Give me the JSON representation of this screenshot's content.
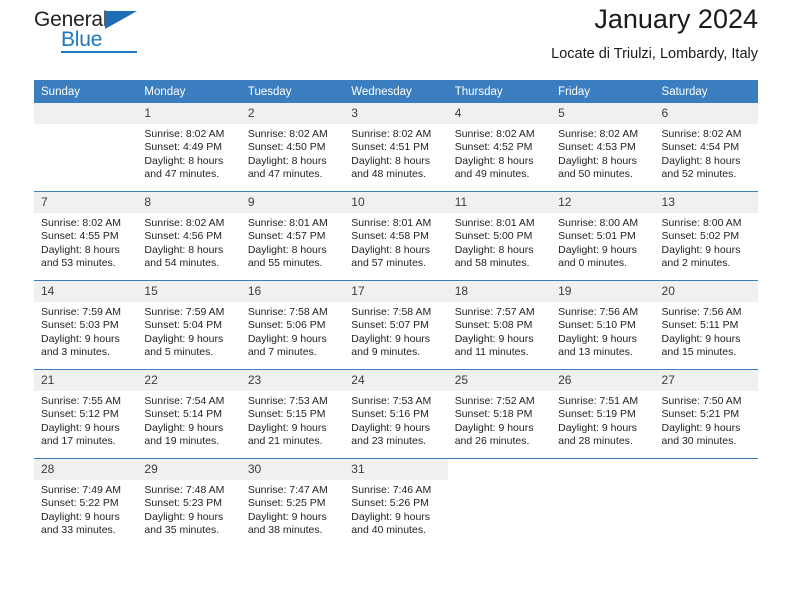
{
  "brand": {
    "name_part1": "General",
    "name_part2": "Blue",
    "logo_icon": "blue-triangle-icon"
  },
  "header": {
    "title": "January 2024",
    "subtitle": "Locate di Triulzi, Lombardy, Italy"
  },
  "colors": {
    "header_blue": "#3a7ebf",
    "brand_blue": "#1f78bf",
    "daynum_band": "#f0f0f0",
    "text": "#232323"
  },
  "weekdays": [
    "Sunday",
    "Monday",
    "Tuesday",
    "Wednesday",
    "Thursday",
    "Friday",
    "Saturday"
  ],
  "labels": {
    "sunrise_prefix": "Sunrise:",
    "sunset_prefix": "Sunset:",
    "daylight_prefix": "Daylight:"
  },
  "weeks": [
    [
      {
        "day": "",
        "empty": true
      },
      {
        "day": "1",
        "sunrise": "Sunrise: 8:02 AM",
        "sunset": "Sunset: 4:49 PM",
        "daylight_line1": "Daylight: 8 hours",
        "daylight_line2": "and 47 minutes."
      },
      {
        "day": "2",
        "sunrise": "Sunrise: 8:02 AM",
        "sunset": "Sunset: 4:50 PM",
        "daylight_line1": "Daylight: 8 hours",
        "daylight_line2": "and 47 minutes."
      },
      {
        "day": "3",
        "sunrise": "Sunrise: 8:02 AM",
        "sunset": "Sunset: 4:51 PM",
        "daylight_line1": "Daylight: 8 hours",
        "daylight_line2": "and 48 minutes."
      },
      {
        "day": "4",
        "sunrise": "Sunrise: 8:02 AM",
        "sunset": "Sunset: 4:52 PM",
        "daylight_line1": "Daylight: 8 hours",
        "daylight_line2": "and 49 minutes."
      },
      {
        "day": "5",
        "sunrise": "Sunrise: 8:02 AM",
        "sunset": "Sunset: 4:53 PM",
        "daylight_line1": "Daylight: 8 hours",
        "daylight_line2": "and 50 minutes."
      },
      {
        "day": "6",
        "sunrise": "Sunrise: 8:02 AM",
        "sunset": "Sunset: 4:54 PM",
        "daylight_line1": "Daylight: 8 hours",
        "daylight_line2": "and 52 minutes."
      }
    ],
    [
      {
        "day": "7",
        "sunrise": "Sunrise: 8:02 AM",
        "sunset": "Sunset: 4:55 PM",
        "daylight_line1": "Daylight: 8 hours",
        "daylight_line2": "and 53 minutes."
      },
      {
        "day": "8",
        "sunrise": "Sunrise: 8:02 AM",
        "sunset": "Sunset: 4:56 PM",
        "daylight_line1": "Daylight: 8 hours",
        "daylight_line2": "and 54 minutes."
      },
      {
        "day": "9",
        "sunrise": "Sunrise: 8:01 AM",
        "sunset": "Sunset: 4:57 PM",
        "daylight_line1": "Daylight: 8 hours",
        "daylight_line2": "and 55 minutes."
      },
      {
        "day": "10",
        "sunrise": "Sunrise: 8:01 AM",
        "sunset": "Sunset: 4:58 PM",
        "daylight_line1": "Daylight: 8 hours",
        "daylight_line2": "and 57 minutes."
      },
      {
        "day": "11",
        "sunrise": "Sunrise: 8:01 AM",
        "sunset": "Sunset: 5:00 PM",
        "daylight_line1": "Daylight: 8 hours",
        "daylight_line2": "and 58 minutes."
      },
      {
        "day": "12",
        "sunrise": "Sunrise: 8:00 AM",
        "sunset": "Sunset: 5:01 PM",
        "daylight_line1": "Daylight: 9 hours",
        "daylight_line2": "and 0 minutes."
      },
      {
        "day": "13",
        "sunrise": "Sunrise: 8:00 AM",
        "sunset": "Sunset: 5:02 PM",
        "daylight_line1": "Daylight: 9 hours",
        "daylight_line2": "and 2 minutes."
      }
    ],
    [
      {
        "day": "14",
        "sunrise": "Sunrise: 7:59 AM",
        "sunset": "Sunset: 5:03 PM",
        "daylight_line1": "Daylight: 9 hours",
        "daylight_line2": "and 3 minutes."
      },
      {
        "day": "15",
        "sunrise": "Sunrise: 7:59 AM",
        "sunset": "Sunset: 5:04 PM",
        "daylight_line1": "Daylight: 9 hours",
        "daylight_line2": "and 5 minutes."
      },
      {
        "day": "16",
        "sunrise": "Sunrise: 7:58 AM",
        "sunset": "Sunset: 5:06 PM",
        "daylight_line1": "Daylight: 9 hours",
        "daylight_line2": "and 7 minutes."
      },
      {
        "day": "17",
        "sunrise": "Sunrise: 7:58 AM",
        "sunset": "Sunset: 5:07 PM",
        "daylight_line1": "Daylight: 9 hours",
        "daylight_line2": "and 9 minutes."
      },
      {
        "day": "18",
        "sunrise": "Sunrise: 7:57 AM",
        "sunset": "Sunset: 5:08 PM",
        "daylight_line1": "Daylight: 9 hours",
        "daylight_line2": "and 11 minutes."
      },
      {
        "day": "19",
        "sunrise": "Sunrise: 7:56 AM",
        "sunset": "Sunset: 5:10 PM",
        "daylight_line1": "Daylight: 9 hours",
        "daylight_line2": "and 13 minutes."
      },
      {
        "day": "20",
        "sunrise": "Sunrise: 7:56 AM",
        "sunset": "Sunset: 5:11 PM",
        "daylight_line1": "Daylight: 9 hours",
        "daylight_line2": "and 15 minutes."
      }
    ],
    [
      {
        "day": "21",
        "sunrise": "Sunrise: 7:55 AM",
        "sunset": "Sunset: 5:12 PM",
        "daylight_line1": "Daylight: 9 hours",
        "daylight_line2": "and 17 minutes."
      },
      {
        "day": "22",
        "sunrise": "Sunrise: 7:54 AM",
        "sunset": "Sunset: 5:14 PM",
        "daylight_line1": "Daylight: 9 hours",
        "daylight_line2": "and 19 minutes."
      },
      {
        "day": "23",
        "sunrise": "Sunrise: 7:53 AM",
        "sunset": "Sunset: 5:15 PM",
        "daylight_line1": "Daylight: 9 hours",
        "daylight_line2": "and 21 minutes."
      },
      {
        "day": "24",
        "sunrise": "Sunrise: 7:53 AM",
        "sunset": "Sunset: 5:16 PM",
        "daylight_line1": "Daylight: 9 hours",
        "daylight_line2": "and 23 minutes."
      },
      {
        "day": "25",
        "sunrise": "Sunrise: 7:52 AM",
        "sunset": "Sunset: 5:18 PM",
        "daylight_line1": "Daylight: 9 hours",
        "daylight_line2": "and 26 minutes."
      },
      {
        "day": "26",
        "sunrise": "Sunrise: 7:51 AM",
        "sunset": "Sunset: 5:19 PM",
        "daylight_line1": "Daylight: 9 hours",
        "daylight_line2": "and 28 minutes."
      },
      {
        "day": "27",
        "sunrise": "Sunrise: 7:50 AM",
        "sunset": "Sunset: 5:21 PM",
        "daylight_line1": "Daylight: 9 hours",
        "daylight_line2": "and 30 minutes."
      }
    ],
    [
      {
        "day": "28",
        "sunrise": "Sunrise: 7:49 AM",
        "sunset": "Sunset: 5:22 PM",
        "daylight_line1": "Daylight: 9 hours",
        "daylight_line2": "and 33 minutes."
      },
      {
        "day": "29",
        "sunrise": "Sunrise: 7:48 AM",
        "sunset": "Sunset: 5:23 PM",
        "daylight_line1": "Daylight: 9 hours",
        "daylight_line2": "and 35 minutes."
      },
      {
        "day": "30",
        "sunrise": "Sunrise: 7:47 AM",
        "sunset": "Sunset: 5:25 PM",
        "daylight_line1": "Daylight: 9 hours",
        "daylight_line2": "and 38 minutes."
      },
      {
        "day": "31",
        "sunrise": "Sunrise: 7:46 AM",
        "sunset": "Sunset: 5:26 PM",
        "daylight_line1": "Daylight: 9 hours",
        "daylight_line2": "and 40 minutes."
      },
      {
        "day": "",
        "empty": true,
        "blank": true
      },
      {
        "day": "",
        "empty": true,
        "blank": true
      },
      {
        "day": "",
        "empty": true,
        "blank": true
      }
    ]
  ]
}
